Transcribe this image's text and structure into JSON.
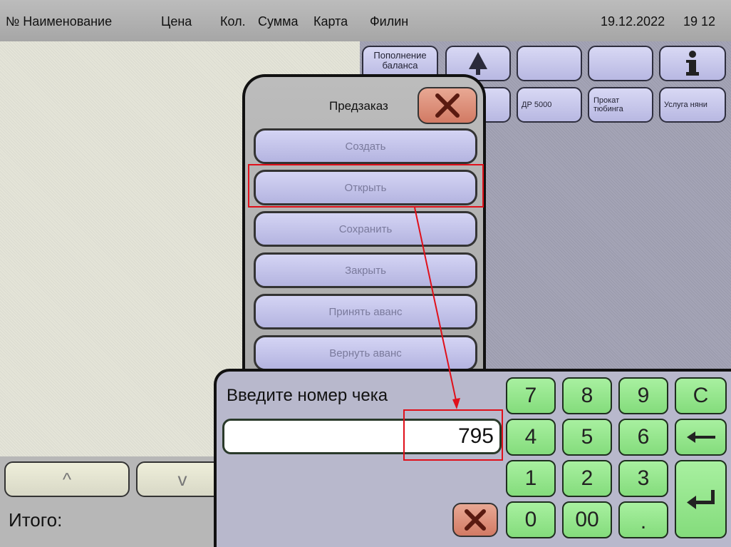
{
  "header": {
    "col_name": "№ Наименование",
    "col_price": "Цена",
    "col_qty": "Кол.",
    "col_sum": "Сумма",
    "col_card": "Карта",
    "user": "Филин",
    "date": "19.12.2022",
    "time": "19 12"
  },
  "grid": {
    "buttons": [
      {
        "label": "Пополнение баланса"
      },
      {
        "label": "",
        "icon": "up-arrow-icon"
      },
      {
        "label": ""
      },
      {
        "label": ""
      },
      {
        "label": "",
        "icon": "info-icon"
      },
      {
        "label": "ДР 5000"
      },
      {
        "label": "Прокат тюбинга"
      },
      {
        "label": "Услуга няни"
      }
    ]
  },
  "bottom": {
    "total_label": "Итого:",
    "scroll_up": "^",
    "scroll_down": "v"
  },
  "predzakaz": {
    "title": "Предзаказ",
    "items": [
      "Создать",
      "Открыть",
      "Сохранить",
      "Закрыть",
      "Принять аванс",
      "Вернуть аванс"
    ]
  },
  "numpad": {
    "prompt": "Введите номер чека",
    "value": "795",
    "keys": [
      "7",
      "8",
      "9",
      "C",
      "4",
      "5",
      "6",
      "1",
      "2",
      "3",
      "0",
      "00",
      "."
    ],
    "backspace_icon": "backspace-arrow-icon",
    "enter_icon": "enter-icon"
  },
  "colors": {
    "highlight": "#e0101a",
    "keypad_green": "#8ce484",
    "cancel_red": "#d27a64"
  }
}
